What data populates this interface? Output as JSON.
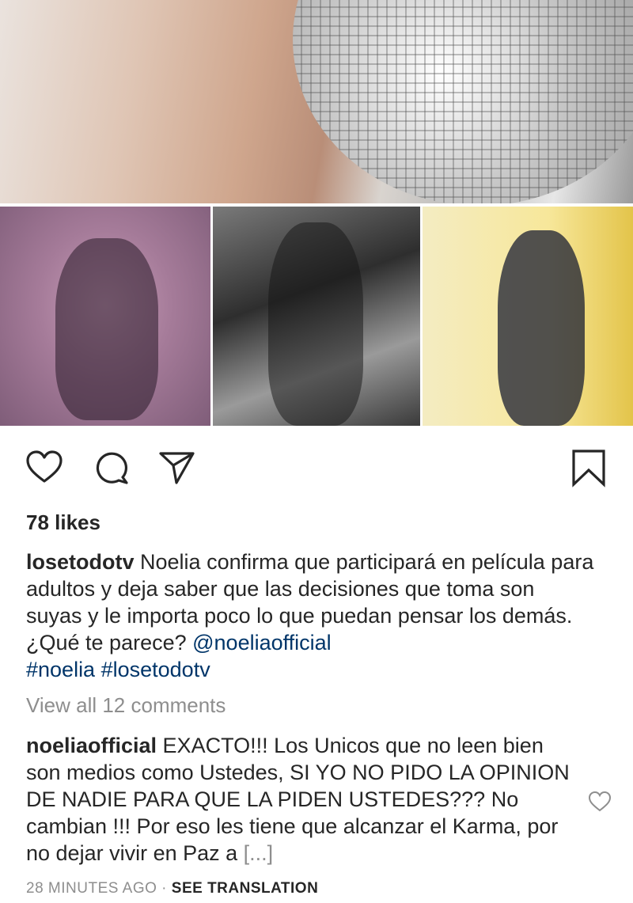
{
  "post": {
    "likes": "78 likes",
    "caption": {
      "username": "losetodotv",
      "text": " Noelia confirma que participará en película para adultos y deja saber que las decisiones que toma son suyas y le importa poco lo que puedan pensar los demás. ¿Qué te parece? ",
      "mention": "@noeliaofficial",
      "hashtags": [
        "#noelia",
        "#losetodotv"
      ]
    },
    "view_all_comments": "View all 12 comments",
    "comment": {
      "username": "noeliaofficial",
      "text": " EXACTO!!! Los Unicos que no leen bien son medios como Ustedes, SI YO NO PIDO LA OPINION DE NADIE PARA QUE LA PIDEN USTEDES??? No cambian !!! Por eso les tiene que alcanzar el Karma, por no dejar vivir en Paz a ",
      "more": "[...]"
    },
    "timestamp": "28 MINUTES AGO",
    "separator": " · ",
    "see_translation": "SEE TRANSLATION"
  },
  "icons": [
    "heart-icon",
    "comment-icon",
    "share-icon",
    "bookmark-icon"
  ],
  "colors": {
    "text": "#262626",
    "muted": "#8e8e8e",
    "link": "#003569"
  }
}
